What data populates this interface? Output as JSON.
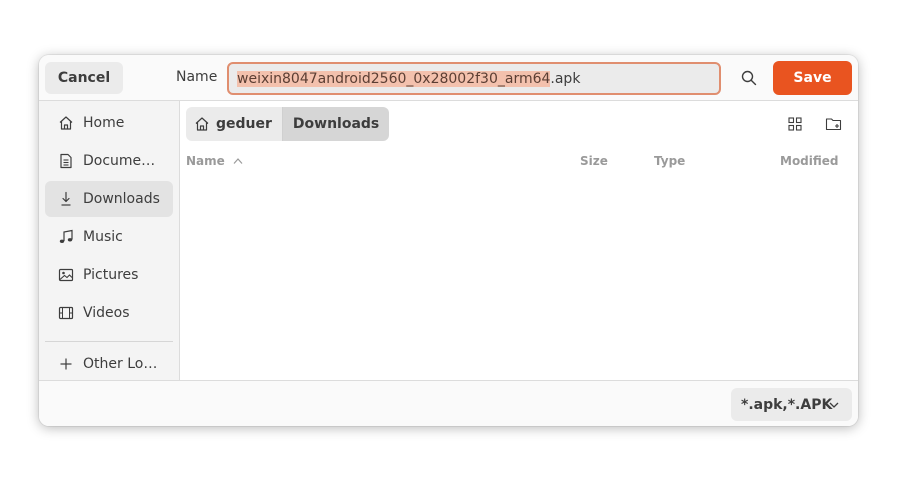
{
  "header": {
    "cancel_label": "Cancel",
    "name_label": "Name",
    "filename_selected": "weixin8047android2560_0x28002f30_arm64",
    "filename_ext": ".apk",
    "search_icon": "search-icon",
    "save_label": "Save"
  },
  "sidebar": {
    "items": [
      {
        "label": "Home",
        "icon": "home-icon"
      },
      {
        "label": "Docume…",
        "icon": "document-icon"
      },
      {
        "label": "Downloads",
        "icon": "download-icon",
        "active": true
      },
      {
        "label": "Music",
        "icon": "music-icon"
      },
      {
        "label": "Pictures",
        "icon": "picture-icon"
      },
      {
        "label": "Videos",
        "icon": "video-icon"
      }
    ],
    "other": {
      "label": "Other Lo…",
      "icon": "plus-icon"
    }
  },
  "pathbar": {
    "crumbs": [
      "geduer",
      "Downloads"
    ]
  },
  "columns": {
    "name": "Name",
    "size": "Size",
    "type": "Type",
    "modified": "Modified"
  },
  "footer": {
    "filter_label": "*.apk,*.APK"
  },
  "colors": {
    "accent": "#e95420",
    "field_border": "#e08e6f",
    "selection": "#f3c1ad"
  }
}
